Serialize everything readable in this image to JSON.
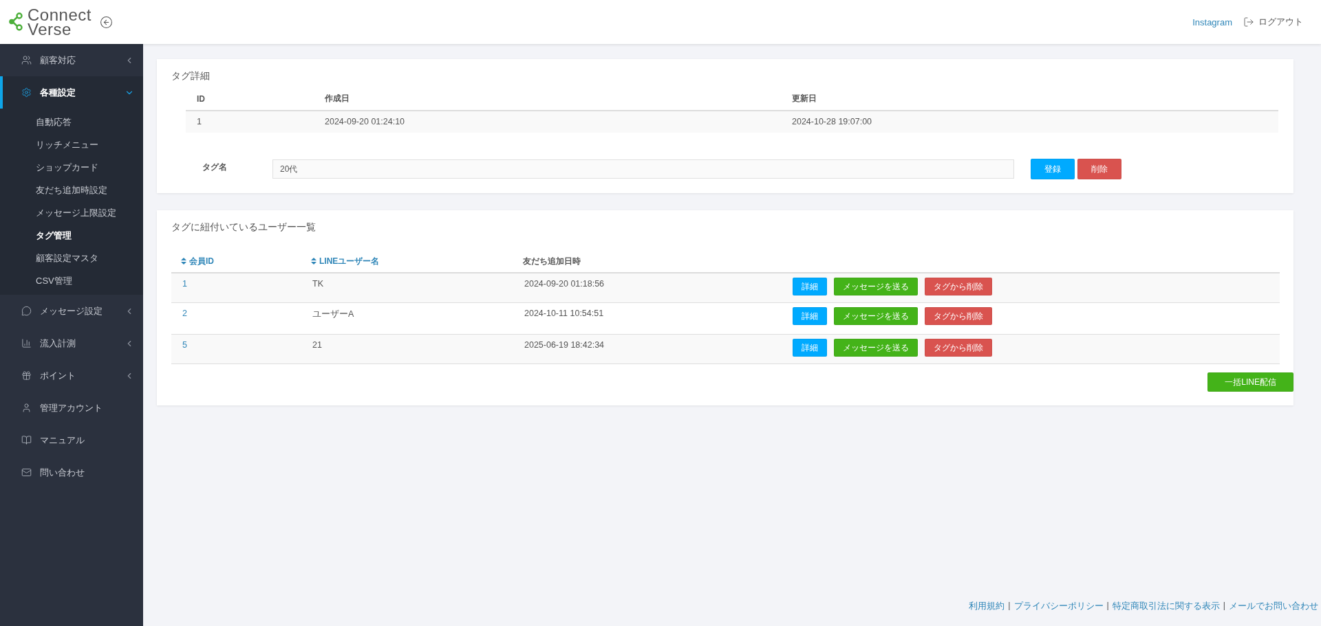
{
  "header": {
    "logo": {
      "line1": "Connect",
      "line2": "Verse"
    },
    "links": [
      {
        "label": "Instagram",
        "kind": "link"
      },
      {
        "label": "ログアウト",
        "kind": "logout"
      }
    ]
  },
  "sidebar": {
    "items": [
      {
        "label": "顧客対応",
        "kind": "group",
        "expanded": false,
        "selected": false
      },
      {
        "label": "各種設定",
        "kind": "group",
        "expanded": true,
        "selected": true,
        "children": [
          {
            "label": "自動応答",
            "selected": false
          },
          {
            "label": "リッチメニュー",
            "selected": false
          },
          {
            "label": "ショップカード",
            "selected": false
          },
          {
            "label": "友だち追加時設定",
            "selected": false
          },
          {
            "label": "メッセージ上限設定",
            "selected": false
          },
          {
            "label": "タグ管理",
            "selected": true
          },
          {
            "label": "顧客設定マスタ",
            "selected": false
          },
          {
            "label": "CSV管理",
            "selected": false
          }
        ]
      },
      {
        "label": "メッセージ設定",
        "kind": "group",
        "expanded": false,
        "selected": false
      },
      {
        "label": "流入計測",
        "kind": "group",
        "expanded": false,
        "selected": false
      },
      {
        "label": "ポイント",
        "kind": "group",
        "expanded": false,
        "selected": false
      },
      {
        "label": "管理アカウント",
        "kind": "link",
        "selected": false
      },
      {
        "label": "マニュアル",
        "kind": "link",
        "selected": false
      },
      {
        "label": "問い合わせ",
        "kind": "link",
        "selected": false
      }
    ]
  },
  "tag_detail": {
    "title": "タグ詳細",
    "table": {
      "columns": [
        "ID",
        "作成日",
        "更新日"
      ],
      "rows": [
        [
          "1",
          "2024-09-20 01:24:10",
          "2024-10-28 19:07:00"
        ]
      ]
    },
    "tag_name": {
      "label": "タグ名",
      "value": "20代"
    },
    "buttons": [
      {
        "label": "登録",
        "kind": "primary"
      },
      {
        "label": "削除",
        "kind": "danger"
      }
    ]
  },
  "users": {
    "title": "タグに紐付いているユーザー一覧",
    "columns": [
      {
        "label": "会員ID",
        "sortable": true
      },
      {
        "label": "LINEユーザー名",
        "sortable": true
      },
      {
        "label": "友だち追加日時",
        "sortable": false
      }
    ],
    "rows": [
      {
        "cells": [
          "1",
          "TK",
          "2024-09-20 01:18:56"
        ],
        "actions": [
          {
            "label": "詳細",
            "kind": "primary"
          },
          {
            "label": "メッセージを送る",
            "kind": "success"
          },
          {
            "label": "タグから削除",
            "kind": "danger"
          }
        ]
      },
      {
        "cells": [
          "2",
          "ユーザーA",
          "2024-10-11 10:54:51"
        ],
        "actions": [
          {
            "label": "詳細",
            "kind": "primary"
          },
          {
            "label": "メッセージを送る",
            "kind": "success"
          },
          {
            "label": "タグから削除",
            "kind": "danger"
          }
        ]
      },
      {
        "cells": [
          "5",
          "21",
          "2025-06-19 18:42:34"
        ],
        "actions": [
          {
            "label": "詳細",
            "kind": "primary"
          },
          {
            "label": "メッセージを送る",
            "kind": "success"
          },
          {
            "label": "タグから削除",
            "kind": "danger"
          }
        ]
      }
    ],
    "bulk_button": {
      "label": "一括LINE配信",
      "kind": "success"
    }
  },
  "footer": {
    "links": [
      "利用規約",
      "プライバシーポリシー",
      "特定商取引法に関する表示",
      "メールでお問い合わせ"
    ],
    "separator": "|"
  }
}
